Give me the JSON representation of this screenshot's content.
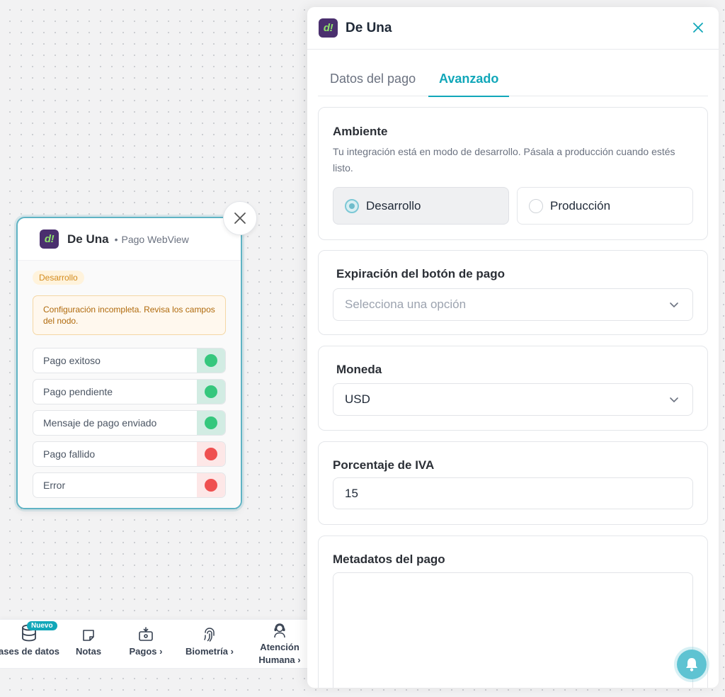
{
  "node": {
    "logo_text": "d!",
    "title": "De Una",
    "separator": "•",
    "subtitle": "Pago WebView",
    "badge": "Desarrollo",
    "warning": "Configuración incompleta. Revisa los campos del nodo.",
    "outlets": [
      {
        "label": "Pago exitoso",
        "status": "ok"
      },
      {
        "label": "Pago pendiente",
        "status": "ok"
      },
      {
        "label": "Mensaje de pago enviado",
        "status": "ok"
      },
      {
        "label": "Pago fallido",
        "status": "error"
      },
      {
        "label": "Error",
        "status": "error"
      }
    ]
  },
  "toolbar": {
    "items": [
      {
        "label": "ases de datos",
        "icon": "database-icon",
        "badge": "Nuevo"
      },
      {
        "label": "Notas",
        "icon": "note-icon"
      },
      {
        "label": "Pagos ›",
        "icon": "payments-icon"
      },
      {
        "label": "Biometría ›",
        "icon": "fingerprint-icon"
      },
      {
        "label": "Atención",
        "label2": "Humana ›",
        "icon": "agent-icon"
      }
    ]
  },
  "panel": {
    "logo_text": "d!",
    "title": "De Una",
    "close": "✕",
    "tabs": [
      {
        "label": "Datos del pago",
        "active": false
      },
      {
        "label": "Avanzado",
        "active": true
      }
    ],
    "ambiente": {
      "title": "Ambiente",
      "description": "Tu integración está en modo de desarrollo. Pásala a producción cuando estés listo.",
      "options": [
        {
          "label": "Desarrollo",
          "selected": true
        },
        {
          "label": "Producción",
          "selected": false
        }
      ]
    },
    "expiracion": {
      "title": "Expiración del botón de pago",
      "placeholder": "Selecciona una opción"
    },
    "moneda": {
      "title": "Moneda",
      "value": "USD"
    },
    "iva": {
      "title": "Porcentaje de IVA",
      "value": "15"
    },
    "metadatos": {
      "title": "Metadatos del pago",
      "value": ""
    }
  },
  "colors": {
    "accent": "#11a7b9",
    "success": "#35c77d",
    "error": "#ef5050",
    "warning_text": "#b06a0c"
  }
}
